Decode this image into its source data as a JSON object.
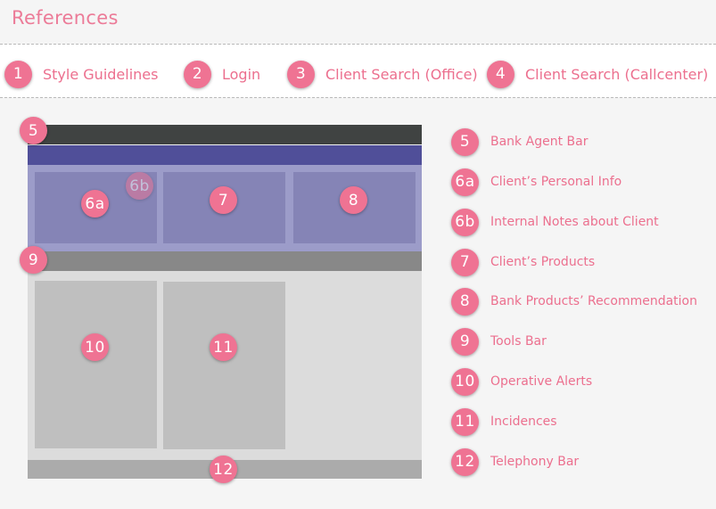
{
  "header": {
    "title": "References"
  },
  "nav": [
    {
      "num": "1",
      "label": "Style Guidelines"
    },
    {
      "num": "2",
      "label": "Login"
    },
    {
      "num": "3",
      "label": "Client Search (Office)"
    },
    {
      "num": "4",
      "label": "Client Search (Callcenter)"
    }
  ],
  "wireframe": {
    "badges": [
      "5",
      "6a",
      "6b",
      "7",
      "8",
      "9",
      "10",
      "11",
      "12"
    ],
    "colors": {
      "agent_bar": "#404342",
      "client_bar": "#504f99",
      "client_area": "#9c9cc9",
      "client_panel": "#8584b6",
      "tools_bar": "#888888",
      "content_area": "#dcdcdc",
      "content_panel": "#bfbfbf",
      "telephony_bar": "#ababab",
      "badge": "#ef7393"
    }
  },
  "legend": [
    {
      "num": "5",
      "label": "Bank Agent Bar"
    },
    {
      "num": "6a",
      "label": "Client’s Personal Info"
    },
    {
      "num": "6b",
      "label": "Internal Notes about Client"
    },
    {
      "num": "7",
      "label": "Client’s Products"
    },
    {
      "num": "8",
      "label": "Bank Products’ Recommendation"
    },
    {
      "num": "9",
      "label": "Tools Bar"
    },
    {
      "num": "10",
      "label": "Operative Alerts"
    },
    {
      "num": "11",
      "label": "Incidences"
    },
    {
      "num": "12",
      "label": "Telephony Bar"
    }
  ]
}
